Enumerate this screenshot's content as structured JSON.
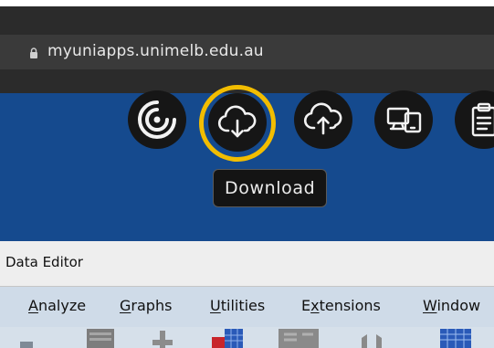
{
  "browser": {
    "url": "myuniapps.unimelb.edu.au"
  },
  "toolbar": {
    "buttons": [
      {
        "id": "apps",
        "icon": "spinner-arc-icon"
      },
      {
        "id": "download",
        "icon": "cloud-download-icon",
        "focused": true
      },
      {
        "id": "upload",
        "icon": "cloud-upload-icon"
      },
      {
        "id": "devices",
        "icon": "monitor-tablet-icon"
      },
      {
        "id": "clipboard",
        "icon": "clipboard-icon"
      }
    ],
    "tooltip": "Download",
    "highlight_color": "#f2bd00",
    "band_color": "#154a8e"
  },
  "window": {
    "title": "Data Editor",
    "menu": [
      {
        "before": "",
        "underlined": "A",
        "after": "nalyze"
      },
      {
        "before": "",
        "underlined": "G",
        "after": "raphs"
      },
      {
        "before": "",
        "underlined": "U",
        "after": "tilities"
      },
      {
        "before": "E",
        "underlined": "x",
        "after": "tensions"
      },
      {
        "before": "",
        "underlined": "W",
        "after": "indow"
      }
    ]
  }
}
